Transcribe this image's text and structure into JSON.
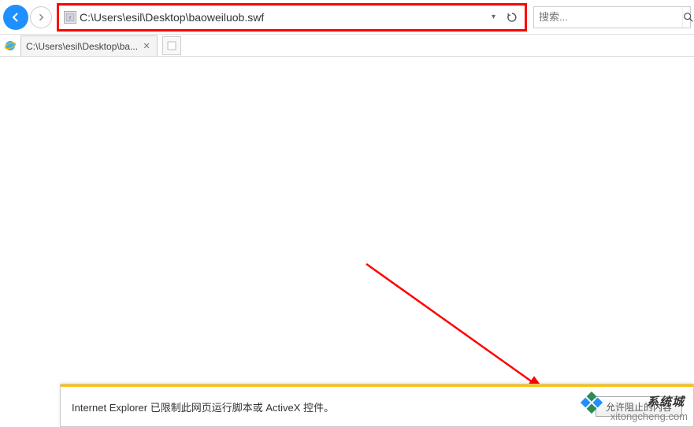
{
  "toolbar": {
    "address": "C:\\Users\\esil\\Desktop\\baoweiluob.swf",
    "search_placeholder": "搜索..."
  },
  "tab": {
    "title": "C:\\Users\\esil\\Desktop\\ba..."
  },
  "notification": {
    "message": "Internet Explorer 已限制此网页运行脚本或 ActiveX 控件。",
    "action_partial": "允许阻止的内容"
  },
  "watermark": {
    "brand_cn": "系统城",
    "url": "xitongcheng.com"
  },
  "colors": {
    "highlight": "#ff0000",
    "accent": "#1e90ff",
    "notif_bar": "#ffc000"
  }
}
